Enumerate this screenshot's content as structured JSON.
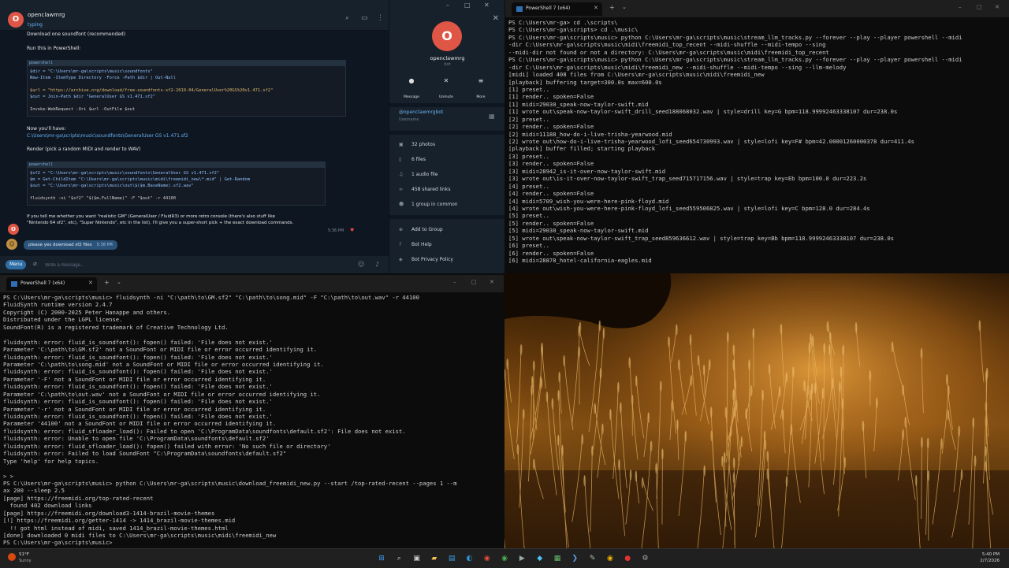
{
  "telegram": {
    "header": {
      "avatar_letter": "O",
      "name": "openclawmrg",
      "status": "typing"
    },
    "messages": {
      "l1": "Download one soundfont (recommended)",
      "l2": "Run this in PowerShell:",
      "code1_lang": "powershell",
      "code1_rows": [
        "$dir = \"C:\\Users\\mr-ga\\scripts\\music\\soundfonts\"",
        "New-Item -ItemType Directory -Force -Path $dir | Out-Null",
        "",
        "$url = \"https://archive.org/download/free-soundfonts-sf2-2019-04/GeneralUser%20GS%20v1.471.sf2\"",
        "$out = Join-Path $dir \"GeneralUser GS v1.471.sf2\"",
        "",
        "Invoke-WebRequest -Uri $url -OutFile $out"
      ],
      "l3": "Now you'll have:",
      "l4": "C:\\Users\\mr-ga\\scripts\\music\\soundfonts\\GeneralUser GS v1.471.sf2",
      "l5": "Render (pick a random MIDI and render to WAV)",
      "code2_lang": "powershell",
      "code2_rows": [
        "$sf2 = \"C:\\Users\\mr-ga\\scripts\\music\\soundfonts\\GeneralUser GS v1.471.sf2\"",
        "$m   = Get-ChildItem \"C:\\Users\\mr-ga\\scripts\\music\\midi\\freemidi_new\\*.mid\" | Get-Random",
        "$out = \"C:\\Users\\mr-ga\\scripts\\music\\out\\$($m.BaseName).sf2.wav\"",
        "",
        "fluidsynth -ni \"$sf2\" \"$($m.FullName)\" -F \"$out\" -r 44100"
      ],
      "l6": "If you tell me whether you want \"realistic GM\" (GeneralUser / FluidR3) or more retro console (there's also stuff like",
      "l7": "\"Nintendo 64 sf2\", etc), \"Super Nintendo\", etc in the list), I'll give you a super-short pick + the exact download commands.",
      "time": "5:36 PM",
      "out_text": "please yes download sf2 files",
      "out_time": "5:38 PM"
    },
    "input": {
      "menu_label": "Menu",
      "placeholder": "Write a message..."
    },
    "profile": {
      "avatar_letter": "O",
      "name": "openclawmrg",
      "sub": "bot",
      "buttons": [
        {
          "label": "Message",
          "icon": "chat-icon"
        },
        {
          "label": "Unmute",
          "icon": "mute-icon"
        },
        {
          "label": "More",
          "icon": "more-icon"
        }
      ],
      "handle": "@openclawmrgbot",
      "username_label": "Username",
      "stats": [
        {
          "label": "32 photos",
          "icon": "photo-icon"
        },
        {
          "label": "6 files",
          "icon": "file-icon"
        },
        {
          "label": "1 audio file",
          "icon": "audio-icon"
        },
        {
          "label": "458 shared links",
          "icon": "link-icon"
        },
        {
          "label": "1 group in common",
          "icon": "group-icon"
        }
      ],
      "actions": [
        {
          "label": "Add to Group",
          "icon": "add-group-icon"
        },
        {
          "label": "Bot Help",
          "icon": "help-icon"
        },
        {
          "label": "Bot Privacy Policy",
          "icon": "privacy-icon"
        }
      ]
    }
  },
  "ps_top": {
    "tab_title": "PowerShell 7 (x64)",
    "lines": [
      "PS C:\\Users\\mr-ga> cd .\\scripts\\",
      "PS C:\\Users\\mr-ga\\scripts> cd .\\music\\",
      "PS C:\\Users\\mr-ga\\scripts\\music> python C:\\Users\\mr-ga\\scripts\\music\\stream_llm_tracks.py --forever --play --player powershell --midi",
      "-dir C:\\Users\\mr-ga\\scripts\\music\\midi\\freemidi_top_recent --midi-shuffle --midi-tempo --sing",
      "--midi-dir not found or not a directory: C:\\Users\\mr-ga\\scripts\\music\\midi\\freemidi_top_recent",
      "PS C:\\Users\\mr-ga\\scripts\\music> python C:\\Users\\mr-ga\\scripts\\music\\stream_llm_tracks.py --forever --play --player powershell --midi",
      "-dir C:\\Users\\mr-ga\\scripts\\music\\midi\\freemidi_new --midi-shuffle --midi-tempo --sing --llm-melody",
      "[midi] loaded 408 files from C:\\Users\\mr-ga\\scripts\\music\\midi\\freemidi_new",
      "[playback] buffering target=300.0s max=600.0s",
      "[1] preset..",
      "[1] render.. spoken=False",
      "[1] midi=29030_speak-now-taylor-swift.mid",
      "[1] wrote out\\speak-now-taylor-swift_drill_seed188068032.wav | style=drill key=G bpm=118.99992463338107 dur=238.0s",
      "[2] preset..",
      "[2] render.. spoken=False",
      "[2] midi=11188_how-do-i-live-trisha-yearwood.mid",
      "[2] wrote out\\how-do-i-live-trisha-yearwood_lofi_seed654730993.wav | style=lofi key=F# bpm=42.00001260000378 dur=411.4s",
      "[playback] buffer filled; starting playback",
      "[3] preset..",
      "[3] render.. spoken=False",
      "[3] midi=28942_is-it-over-now-taylor-swift.mid",
      "[3] wrote out\\is-it-over-now-taylor-swift_trap_seed715717156.wav | style=trap key=Eb bpm=100.0 dur=223.2s",
      "[4] preset..",
      "[4] render.. spoken=False",
      "[4] midi=5709_wish-you-were-here-pink-floyd.mid",
      "[4] wrote out\\wish-you-were-here-pink-floyd_lofi_seed559506825.wav | style=lofi key=C bpm=128.0 dur=284.4s",
      "[5] preset..",
      "[5] render.. spoken=False",
      "[5] midi=29030_speak-now-taylor-swift.mid",
      "[5] wrote out\\speak-now-taylor-swift_trap_seed859636612.wav | style=trap key=Bb bpm=118.99992463338107 dur=238.0s",
      "[6] preset..",
      "[6] render.. spoken=False",
      "[6] midi=28878_hotel-california-eagles.mid"
    ]
  },
  "ps_bottom": {
    "tab_title": "PowerShell 7 (x64)",
    "lines": [
      "PS C:\\Users\\mr-ga\\scripts\\music> fluidsynth -ni \"C:\\path\\to\\GM.sf2\" \"C:\\path\\to\\song.mid\" -F \"C:\\path\\to\\out.wav\" -r 44100",
      "FluidSynth runtime version 2.4.7",
      "Copyright (C) 2000-2025 Peter Hanappe and others.",
      "Distributed under the LGPL license.",
      "SoundFont(R) is a registered trademark of Creative Technology Ltd.",
      "",
      "fluidsynth: error: fluid_is_soundfont(): fopen() failed: 'File does not exist.'",
      "Parameter 'C:\\path\\to\\GM.sf2' not a SoundFont or MIDI file or error occurred identifying it.",
      "fluidsynth: error: fluid_is_soundfont(): fopen() failed: 'File does not exist.'",
      "Parameter 'C:\\path\\to\\song.mid' not a SoundFont or MIDI file or error occurred identifying it.",
      "fluidsynth: error: fluid_is_soundfont(): fopen() failed: 'File does not exist.'",
      "Parameter '-F' not a SoundFont or MIDI file or error occurred identifying it.",
      "fluidsynth: error: fluid_is_soundfont(): fopen() failed: 'File does not exist.'",
      "Parameter 'C:\\path\\to\\out.wav' not a SoundFont or MIDI file or error occurred identifying it.",
      "fluidsynth: error: fluid_is_soundfont(): fopen() failed: 'File does not exist.'",
      "Parameter '-r' not a SoundFont or MIDI file or error occurred identifying it.",
      "fluidsynth: error: fluid_is_soundfont(): fopen() failed: 'File does not exist.'",
      "Parameter '44100' not a SoundFont or MIDI file or error occurred identifying it.",
      "fluidsynth: error: fluid_sfloader_load(): Failed to open 'C:\\ProgramData\\soundfonts\\default.sf2': File does not exist.",
      "fluidsynth: error: Unable to open file 'C:\\ProgramData\\soundfonts\\default.sf2'",
      "fluidsynth: error: fluid_sfloader_load(): fopen() failed with error: 'No such file or directory'",
      "fluidsynth: error: Failed to load SoundFont \"C:\\ProgramData\\soundfonts\\default.sf2\"",
      "Type 'help' for help topics.",
      "",
      "> >",
      "PS C:\\Users\\mr-ga\\scripts\\music> python C:\\Users\\mr-ga\\scripts\\music\\download_freemidi_new.py --start /top-rated-recent --pages 1 --m",
      "ax 200 --sleep 2.5",
      "[page] https://freemidi.org/top-rated-recent",
      "  found 402 download links",
      "[page] https://freemidi.org/download3-1414-brazil-movie-themes",
      "[!] https://freemidi.org/getter-1414 -> 1414_brazil-movie-themes.mid",
      "  !! got html instead of midi, saved 1414_brazil-movie-themes.html",
      "[done] downloaded 0 midi files to C:\\Users\\mr-ga\\scripts\\music\\midi\\freemidi_new",
      "PS C:\\Users\\mr-ga\\scripts\\music>"
    ]
  },
  "taskbar": {
    "weather_temp": "51°F",
    "weather_text": "Sunny",
    "time": "5:40 PM",
    "date": "2/7/2026",
    "apps": [
      {
        "name": "windows-start-icon",
        "glyph": "⊞",
        "color": "#3a9cf0"
      },
      {
        "name": "search-icon",
        "glyph": "⌕",
        "color": "#cccccc"
      },
      {
        "name": "task-view-icon",
        "glyph": "▣",
        "color": "#cccccc"
      },
      {
        "name": "file-explorer-icon",
        "glyph": "▰",
        "color": "#f2c14e"
      },
      {
        "name": "store-icon",
        "glyph": "▤",
        "color": "#3aa0e8"
      },
      {
        "name": "edge-icon",
        "glyph": "◐",
        "color": "#2f9ad8"
      },
      {
        "name": "chrome-icon",
        "glyph": "◉",
        "color": "#e24c3c"
      },
      {
        "name": "chrome-icon-2",
        "glyph": "◉",
        "color": "#4caf50"
      },
      {
        "name": "terminal-icon",
        "glyph": "▶",
        "color": "#9aa"
      },
      {
        "name": "app-icon",
        "glyph": "◆",
        "color": "#4fc3f7"
      },
      {
        "name": "calculator-icon",
        "glyph": "▦",
        "color": "#66bb6a"
      },
      {
        "name": "powershell-icon",
        "glyph": "❯",
        "color": "#5c9fe6"
      },
      {
        "name": "notepad-icon",
        "glyph": "✎",
        "color": "#bbb"
      },
      {
        "name": "chrome-icon-3",
        "glyph": "◉",
        "color": "#f4b400"
      },
      {
        "name": "opera-icon",
        "glyph": "●",
        "color": "#d33"
      },
      {
        "name": "settings-icon",
        "glyph": "⚙",
        "color": "#aaa"
      }
    ]
  }
}
